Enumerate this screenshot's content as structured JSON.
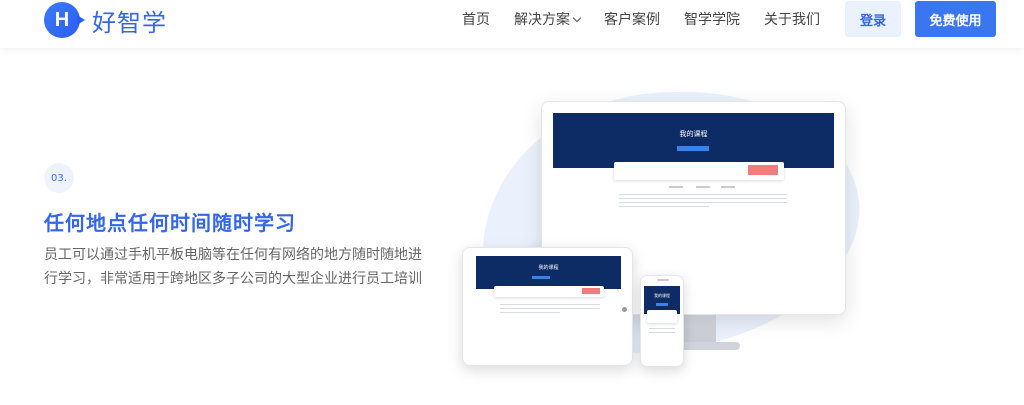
{
  "nav": {
    "logo_letter": "H",
    "logo_text": "好智学",
    "items": [
      {
        "label": "首页"
      },
      {
        "label": "解决方案"
      },
      {
        "label": "客户案例"
      },
      {
        "label": "智学学院"
      },
      {
        "label": "关于我们"
      }
    ],
    "login_label": "登录",
    "trial_label": "免费使用"
  },
  "feature": {
    "step": "03.",
    "title": "任何地点任何时间随时学习",
    "description": "员工可以通过手机平板电脑等在任何有网络的地方随时随地进行学习，非常适用于跨地区多子公司的大型企业进行员工培训"
  },
  "devices": {
    "screen_title": "我的课程",
    "colors": {
      "screen_header": "#0d2c66",
      "accent": "#3a76f2",
      "badge": "#f07c7c"
    }
  }
}
